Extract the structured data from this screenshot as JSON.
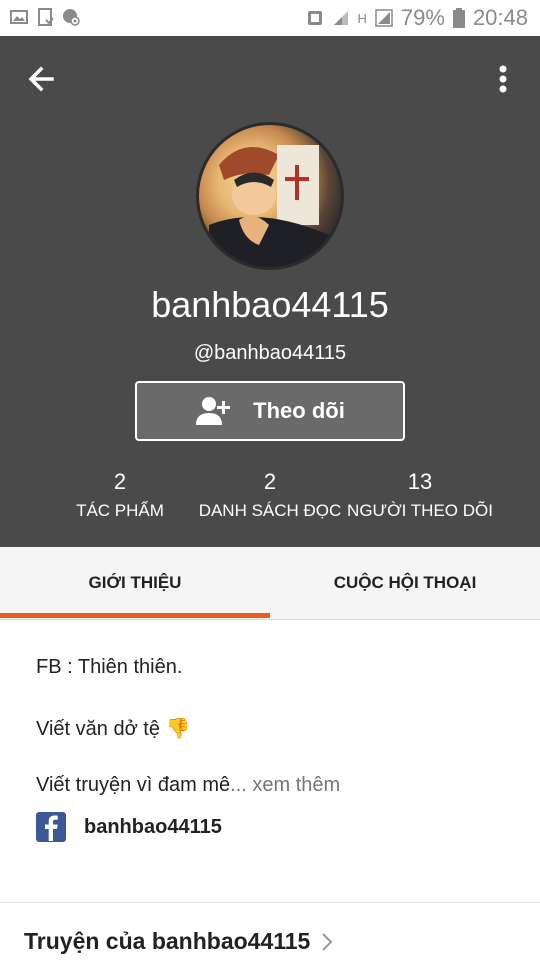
{
  "status_bar": {
    "battery_percent": "79%",
    "time": "20:48",
    "network_label": "H"
  },
  "profile": {
    "display_name": "banhbao44115",
    "handle": "@banhbao44115",
    "follow_button_label": "Theo dõi",
    "stats": [
      {
        "value": "2",
        "label": "TÁC PHẨM"
      },
      {
        "value": "2",
        "label": "DANH SÁCH ĐỌC"
      },
      {
        "value": "13",
        "label": "NGƯỜI THEO DÕI"
      }
    ]
  },
  "tabs": [
    {
      "label": "GIỚI THIỆU",
      "active": true
    },
    {
      "label": "CUỘC HỘI THOẠI",
      "active": false
    }
  ],
  "about": {
    "line1": "FB : Thiên thiên.",
    "line2": "Viết văn dở tệ",
    "line2_emoji": "👎",
    "line3": "Viết truyện vì đam mê",
    "see_more": "... xem thêm",
    "facebook_name": "banhbao44115"
  },
  "stories_link": "Truyện của banhbao44115",
  "colors": {
    "header_bg": "#4a4a4a",
    "accent": "#f05a1e",
    "facebook_blue": "#3b5998"
  }
}
